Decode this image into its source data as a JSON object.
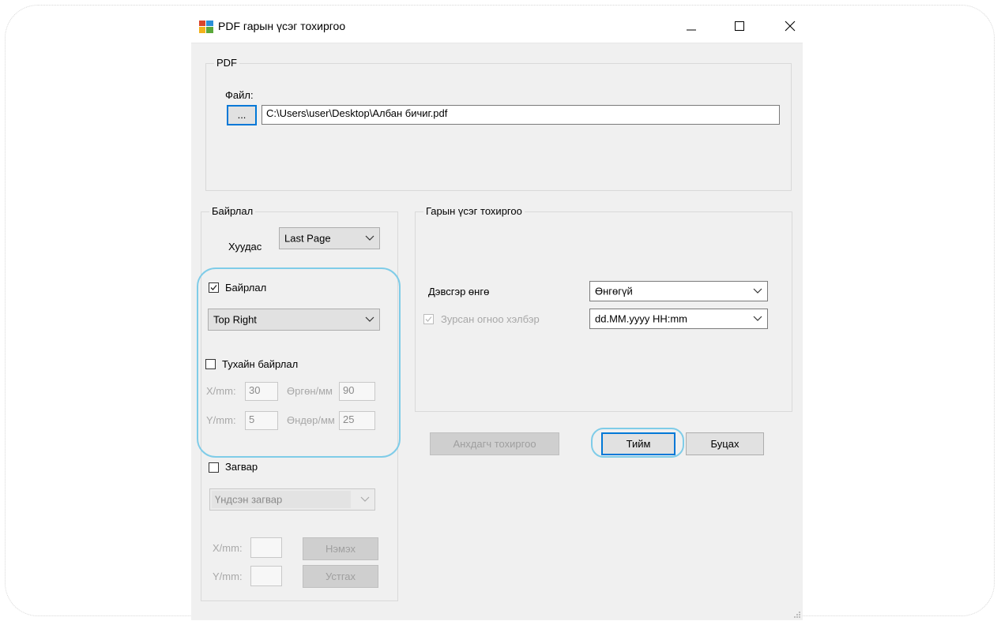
{
  "window": {
    "title": "PDF гарын үсэг тохиргоо",
    "minimize": "—",
    "maximize": "☐",
    "close": "✕"
  },
  "pdf_group": {
    "label": "PDF",
    "file_label": "Файл:",
    "browse_label": "...",
    "file_path": "C:\\Users\\user\\Desktop\\Албан бичиг.pdf"
  },
  "layout_group": {
    "label": "Байрлал",
    "page_label": "Хуудас",
    "page_value": "Last Page",
    "position_checkbox_label": "Байрлал",
    "position_checked": true,
    "position_value": "Top Right",
    "custom_position_label": "Тухайн байрлал",
    "custom_position_checked": false,
    "x_label": "X/mm:",
    "x_value": "30",
    "width_label": "Өргөн/мм",
    "width_value": "90",
    "y_label": "Y/mm:",
    "y_value": "5",
    "height_label": "Өндөр/мм",
    "height_value": "25",
    "template_checkbox_label": "Загвар",
    "template_checked": false,
    "template_value": "Үндсэн загвар",
    "tx_label": "X/mm:",
    "ty_label": "Y/mm:",
    "add_label": "Нэмэх",
    "remove_label": "Устгах"
  },
  "signature_group": {
    "label": "Гарын үсэг тохиргоо",
    "bg_color_label": "Дэвсгэр өнгө",
    "bg_color_value": "Өнгөгүй",
    "date_format_label": "Зурсан огноо хэлбэр",
    "date_format_checked": true,
    "date_format_value": "dd.MM.yyyy HH:mm"
  },
  "buttons": {
    "defaults": "Анхдагч тохиргоо",
    "ok": "Тийм",
    "cancel": "Буцах"
  },
  "colors": {
    "accent": "#0078d7",
    "highlight": "#7fcce8",
    "window_bg": "#f0f0f0"
  }
}
